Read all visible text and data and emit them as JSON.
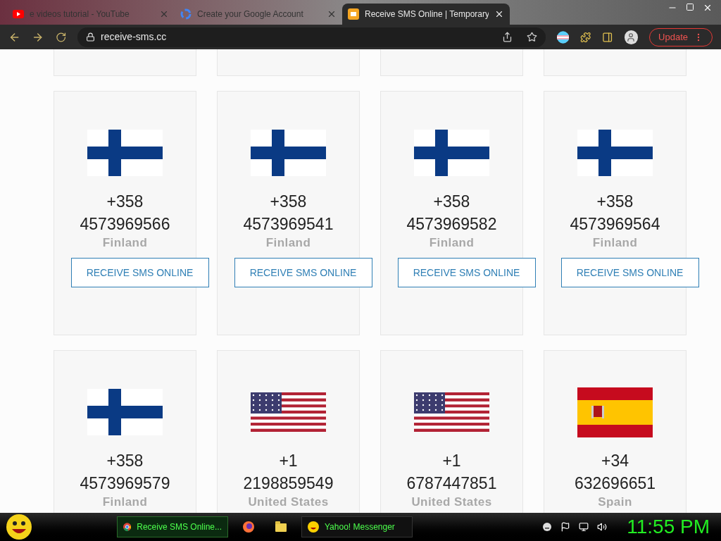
{
  "browser": {
    "tabs": [
      {
        "title": "e videos tutorial - YouTube",
        "kind": "youtube",
        "selected": false
      },
      {
        "title": "Create your Google Account",
        "kind": "google",
        "selected": false
      },
      {
        "title": "Receive SMS Online | Temporary",
        "kind": "site",
        "selected": true
      }
    ],
    "url": "receive-sms.cc",
    "update_button": "Update"
  },
  "numbers": [
    {
      "kind": "finland",
      "code": "+358",
      "number": "4573969566",
      "country": "Finland",
      "button": "RECEIVE SMS ONLINE"
    },
    {
      "kind": "finland",
      "code": "+358",
      "number": "4573969541",
      "country": "Finland",
      "button": "RECEIVE SMS ONLINE"
    },
    {
      "kind": "finland",
      "code": "+358",
      "number": "4573969582",
      "country": "Finland",
      "button": "RECEIVE SMS ONLINE"
    },
    {
      "kind": "finland",
      "code": "+358",
      "number": "4573969564",
      "country": "Finland",
      "button": "RECEIVE SMS ONLINE"
    },
    {
      "kind": "finland",
      "code": "+358",
      "number": "4573969579",
      "country": "Finland"
    },
    {
      "kind": "us",
      "code": "+1",
      "number": "2198859549",
      "country": "United States"
    },
    {
      "kind": "us",
      "code": "+1",
      "number": "6787447851",
      "country": "United States"
    },
    {
      "kind": "spain",
      "code": "+34",
      "number": "632696651",
      "country": "Spain"
    }
  ],
  "taskbar": {
    "items": [
      {
        "label": "Receive SMS Online...",
        "kind": "chrome",
        "selected": true
      },
      {
        "kind": "firefox",
        "selected": false
      },
      {
        "kind": "folder",
        "selected": false
      },
      {
        "label": "Yahoo! Messenger",
        "kind": "yahoo",
        "selected": false
      }
    ],
    "clock": "11:55 PM"
  }
}
